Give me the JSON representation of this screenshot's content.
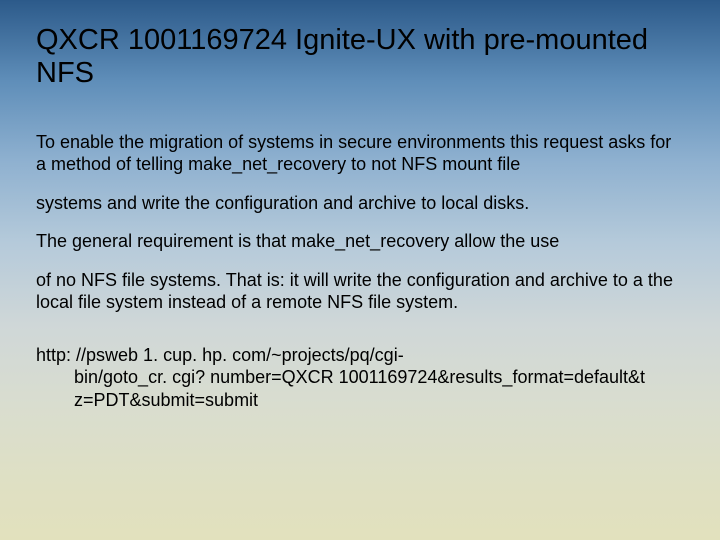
{
  "title": "QXCR 1001169724  Ignite-UX with pre-mounted NFS",
  "p1": "To enable the migration of systems in secure environments this request asks for a method of telling make_net_recovery to not NFS mount file",
  "p2": "systems and write the configuration and archive to local disks.",
  "p3": "The general requirement is that make_net_recovery allow the use",
  "p4": "of no NFS file systems. That is: it will write the configuration and archive to a the local file system instead of a remote NFS file system.",
  "url_line1": "http: //psweb 1. cup. hp. com/~projects/pq/cgi-",
  "url_line2": "bin/goto_cr. cgi? number=QXCR 1001169724&results_format=default&t",
  "url_line3": "z=PDT&submit=submit"
}
